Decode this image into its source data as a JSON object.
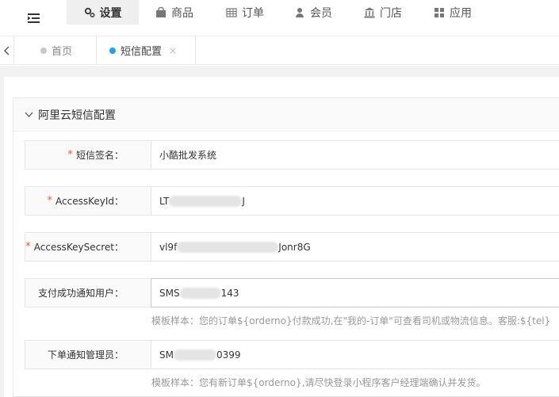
{
  "topnav": {
    "items": [
      {
        "label": "设置",
        "icon": "gear-icon"
      },
      {
        "label": "商品",
        "icon": "bag-icon"
      },
      {
        "label": "订单",
        "icon": "table-icon"
      },
      {
        "label": "会员",
        "icon": "user-icon"
      },
      {
        "label": "门店",
        "icon": "bank-icon"
      },
      {
        "label": "应用",
        "icon": "grid-icon"
      }
    ]
  },
  "tabs": [
    {
      "label": "首页"
    },
    {
      "label": "短信配置",
      "close": "×"
    }
  ],
  "section": {
    "title": "阿里云短信配置"
  },
  "form": {
    "rows": [
      {
        "label": "短信签名：",
        "required": "*",
        "value": "小酷批发系统"
      },
      {
        "label": "AccessKeyId：",
        "required": "*",
        "value_start": "LT",
        "value_end": "J"
      },
      {
        "label": "AccessKeySecret：",
        "required": "*",
        "value_start": "vl9f",
        "value_end": "Jonr8G"
      },
      {
        "label": "支付成功通知用户：",
        "value_start": "SMS",
        "value_end": "143",
        "hint": "模板样本：您的订单${orderno}付款成功,在\"我的-订单\"可查看司机或物流信息。客服:${tel}"
      },
      {
        "label": "下单通知管理员：",
        "value_start": "SM",
        "value_end": "0399",
        "hint": "模板样本：您有新订单${orderno},请尽快登录小程序客户经理端确认并发货。"
      }
    ]
  },
  "colors": {
    "accent": "#1e9fff",
    "required": "#ff5722",
    "active_nav_bg": "#efefef"
  }
}
